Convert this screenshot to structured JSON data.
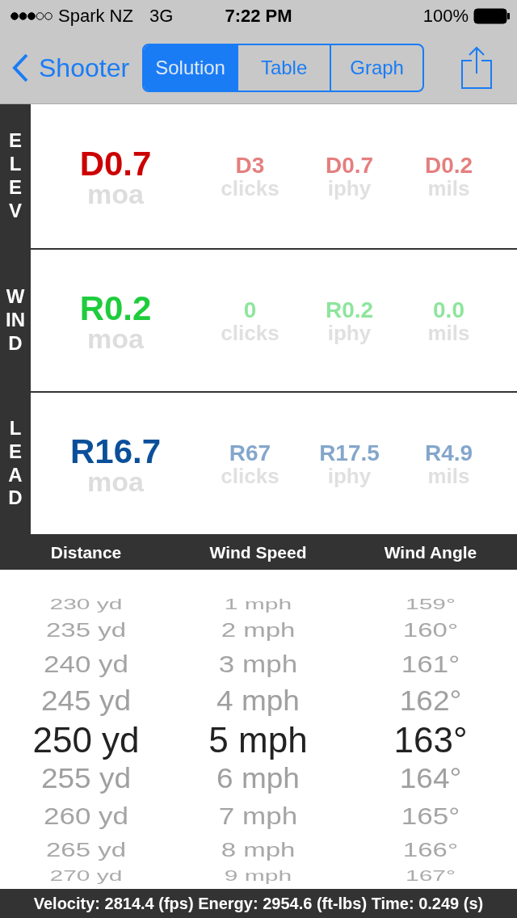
{
  "status_bar": {
    "carrier": "Spark NZ",
    "network": "3G",
    "time": "7:22 PM",
    "battery": "100%"
  },
  "nav": {
    "back": "Shooter"
  },
  "tabs": [
    {
      "label": "Solution",
      "selected": true
    },
    {
      "label": "Table",
      "selected": false
    },
    {
      "label": "Graph",
      "selected": false
    }
  ],
  "sections": [
    {
      "label": "ELEV",
      "color": "#cc0000",
      "main": {
        "value": "D0.7",
        "unit": "moa"
      },
      "others": [
        {
          "value": "D3",
          "unit": "clicks"
        },
        {
          "value": "D0.7",
          "unit": "iphy"
        },
        {
          "value": "D0.2",
          "unit": "mils"
        }
      ]
    },
    {
      "label": "WIND",
      "color": "#1ecc3c",
      "main": {
        "value": "R0.2",
        "unit": "moa"
      },
      "others": [
        {
          "value": "0",
          "unit": "clicks"
        },
        {
          "value": "R0.2",
          "unit": "iphy"
        },
        {
          "value": "0.0",
          "unit": "mils"
        }
      ]
    },
    {
      "label": "LEAD",
      "color": "#0b4f99",
      "main": {
        "value": "R16.7",
        "unit": "moa"
      },
      "others": [
        {
          "value": "R67",
          "unit": "clicks"
        },
        {
          "value": "R17.5",
          "unit": "iphy"
        },
        {
          "value": "R4.9",
          "unit": "mils"
        }
      ]
    }
  ],
  "picker": {
    "columns": [
      {
        "heading": "Distance",
        "items": [
          {
            "label": "230 yd",
            "selected": false
          },
          {
            "label": "235 yd",
            "selected": false
          },
          {
            "label": "240 yd",
            "selected": false
          },
          {
            "label": "245 yd",
            "selected": false
          },
          {
            "label": "250 yd",
            "selected": true
          },
          {
            "label": "255 yd",
            "selected": false
          },
          {
            "label": "260 yd",
            "selected": false
          },
          {
            "label": "265 yd",
            "selected": false
          },
          {
            "label": "270 yd",
            "selected": false
          }
        ]
      },
      {
        "heading": "Wind Speed",
        "items": [
          {
            "label": "1 mph",
            "selected": false
          },
          {
            "label": "2 mph",
            "selected": false
          },
          {
            "label": "3 mph",
            "selected": false
          },
          {
            "label": "4 mph",
            "selected": false
          },
          {
            "label": "5 mph",
            "selected": true
          },
          {
            "label": "6 mph",
            "selected": false
          },
          {
            "label": "7 mph",
            "selected": false
          },
          {
            "label": "8 mph",
            "selected": false
          },
          {
            "label": "9 mph",
            "selected": false
          }
        ]
      },
      {
        "heading": "Wind Angle",
        "items": [
          {
            "label": "159°",
            "selected": false
          },
          {
            "label": "160°",
            "selected": false
          },
          {
            "label": "161°",
            "selected": false
          },
          {
            "label": "162°",
            "selected": false
          },
          {
            "label": "163°",
            "selected": true
          },
          {
            "label": "164°",
            "selected": false
          },
          {
            "label": "165°",
            "selected": false
          },
          {
            "label": "166°",
            "selected": false
          },
          {
            "label": "167°",
            "selected": false
          }
        ]
      }
    ]
  },
  "footer": "Velocity: 2814.4 (fps) Energy: 2954.6 (ft-lbs) Time: 0.249 (s)"
}
